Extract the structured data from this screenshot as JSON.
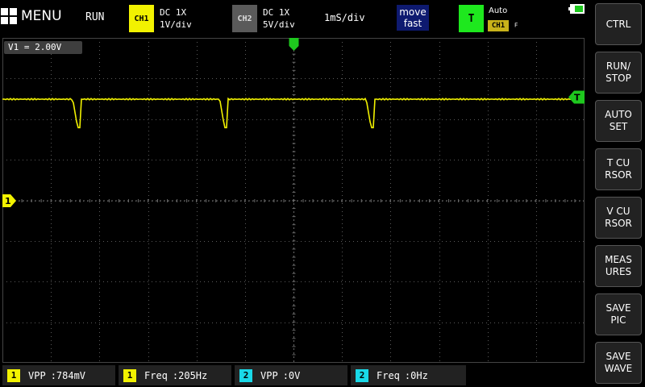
{
  "header": {
    "menu_label": "MENU",
    "run_state": "RUN",
    "ch1": {
      "badge": "CH1",
      "coupling": "DC  1X",
      "scale": "1V/div"
    },
    "ch2": {
      "badge": "CH2",
      "coupling": "DC  1X",
      "scale": "5V/div"
    },
    "timebase": "1mS/div",
    "move": {
      "line1": "move",
      "line2": "fast"
    },
    "trigger": {
      "badge": "T",
      "mode": "Auto",
      "source": "CH1",
      "edge": "ꟳ"
    }
  },
  "screen": {
    "cursor_readout": "V1 = 2.00V",
    "ch1_marker": "1",
    "trigger_level_marker": "T",
    "waveform": {
      "high_level_div": 2.5,
      "dip_level_div": 1.8,
      "period_div": 3.03,
      "dip_positions_div": [
        1.45,
        4.48,
        7.5
      ]
    }
  },
  "side_buttons": [
    {
      "label": "CTRL"
    },
    {
      "label": "RUN/\nSTOP"
    },
    {
      "label": "AUTO\nSET"
    },
    {
      "label": "T CU\nRSOR"
    },
    {
      "label": "V CU\nRSOR"
    },
    {
      "label": "MEAS\nURES"
    },
    {
      "label": "SAVE\nPIC"
    },
    {
      "label": "SAVE\nWAVE"
    }
  ],
  "measurements": [
    {
      "channel": "1",
      "label": "VPP",
      "value": ":784mV",
      "color": "#f2f200"
    },
    {
      "channel": "1",
      "label": "Freq",
      "value": ":205Hz",
      "color": "#f2f200"
    },
    {
      "channel": "2",
      "label": "VPP",
      "value": ":0V",
      "color": "#19d9e8"
    },
    {
      "channel": "2",
      "label": "Freq",
      "value": ":0Hz",
      "color": "#19d9e8"
    }
  ],
  "colors": {
    "ch1": "#f2f200",
    "ch2": "#5a5a5a",
    "trigger": "#1ee81e",
    "background": "#000000"
  }
}
